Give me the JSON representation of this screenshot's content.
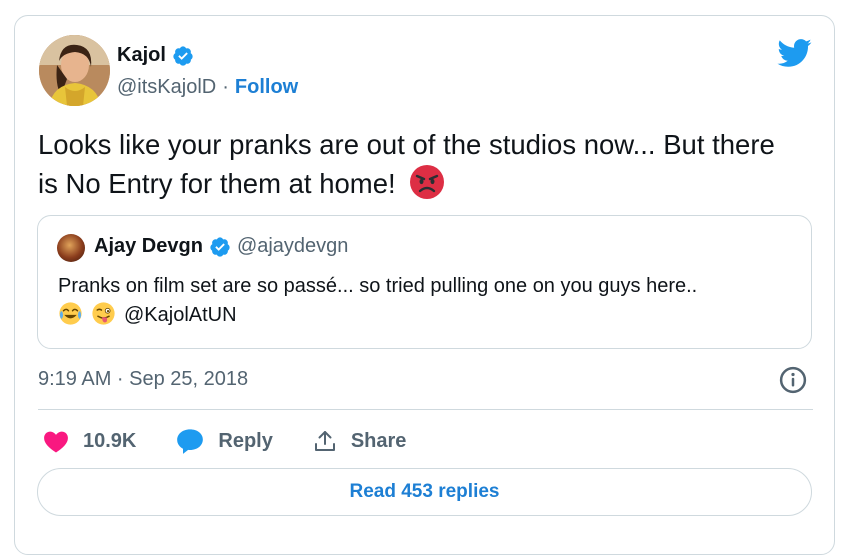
{
  "tweet": {
    "author_name": "Kajol",
    "author_handle": "@itsKajolD",
    "separator": "·",
    "follow_label": "Follow",
    "text": "Looks like your pranks are out of the studios now... But there is No Entry for them at home!",
    "timestamp": "9:19 AM · Sep 25, 2018"
  },
  "quoted": {
    "author_name": "Ajay Devgn",
    "author_handle": "@ajaydevgn",
    "text": "Pranks on film set are so passé... so tried pulling one on you guys here..",
    "mention": "@KajolAtUN"
  },
  "actions": {
    "likes_count": "10.9K",
    "reply_label": "Reply",
    "share_label": "Share"
  },
  "read_replies_label": "Read 453 replies",
  "colors": {
    "accent": "#1d9bf0",
    "like": "#f91880",
    "muted": "#536471",
    "border": "#cfd9de"
  },
  "icons": [
    "verified-badge-icon",
    "twitter-bird-icon",
    "angry-face-emoji",
    "tears-of-joy-emoji",
    "winking-tongue-emoji",
    "info-icon",
    "heart-icon",
    "reply-bubble-icon",
    "share-icon"
  ]
}
